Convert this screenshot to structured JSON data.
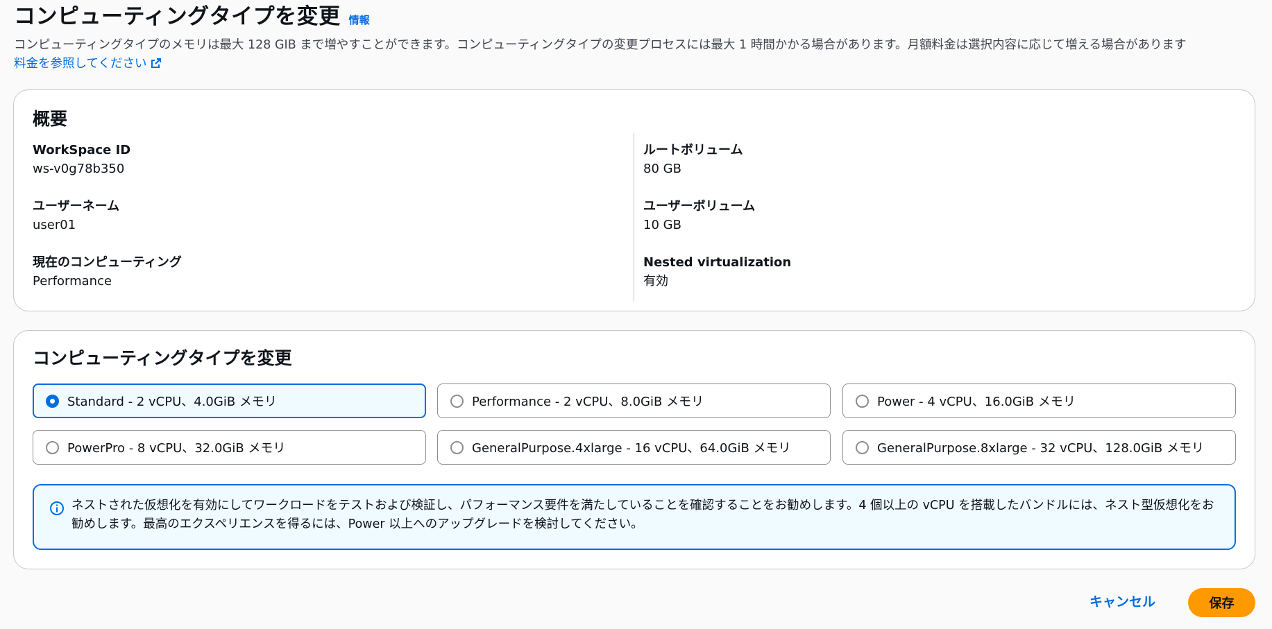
{
  "header": {
    "title": "コンピューティングタイプを変更",
    "info_link": "情報",
    "description": "コンピューティングタイプのメモリは最大 128 GIB まで増やすことができます。コンピューティングタイプの変更プロセスには最大 1 時間かかる場合があります。月額料金は選択内容に応じて増える場合があります",
    "pricing_link": "料金を参照してください"
  },
  "summary": {
    "heading": "概要",
    "left": [
      {
        "label": "WorkSpace ID",
        "value": "ws-v0g78b350"
      },
      {
        "label": "ユーザーネーム",
        "value": "user01"
      },
      {
        "label": "現在のコンピューティング",
        "value": "Performance"
      }
    ],
    "right": [
      {
        "label": "ルートボリューム",
        "value": "80 GB"
      },
      {
        "label": "ユーザーボリューム",
        "value": "10 GB"
      },
      {
        "label": "Nested virtualization",
        "value": "有効"
      }
    ]
  },
  "change": {
    "heading": "コンピューティングタイプを変更",
    "selected_index": 0,
    "options": [
      {
        "label": "Standard - 2 vCPU、4.0GiB メモリ"
      },
      {
        "label": "Performance - 2 vCPU、8.0GiB メモリ"
      },
      {
        "label": "Power - 4 vCPU、16.0GiB メモリ"
      },
      {
        "label": "PowerPro - 8 vCPU、32.0GiB メモリ"
      },
      {
        "label": "GeneralPurpose.4xlarge - 16 vCPU、64.0GiB メモリ"
      },
      {
        "label": "GeneralPurpose.8xlarge - 32 vCPU、128.0GiB メモリ"
      }
    ],
    "alert_text": "ネストされた仮想化を有効にしてワークロードをテストおよび検証し、パフォーマンス要件を満たしていることを確認することをお勧めします。4 個以上の vCPU を搭載したバンドルには、ネスト型仮想化をお勧めします。最高のエクスペリエンスを得るには、Power 以上へのアップグレードを検討してください。"
  },
  "footer": {
    "cancel_label": "キャンセル",
    "save_label": "保存"
  },
  "colors": {
    "accent": "#006ce0",
    "primary_button": "#ff9900",
    "alert_background": "#f0fbff"
  }
}
